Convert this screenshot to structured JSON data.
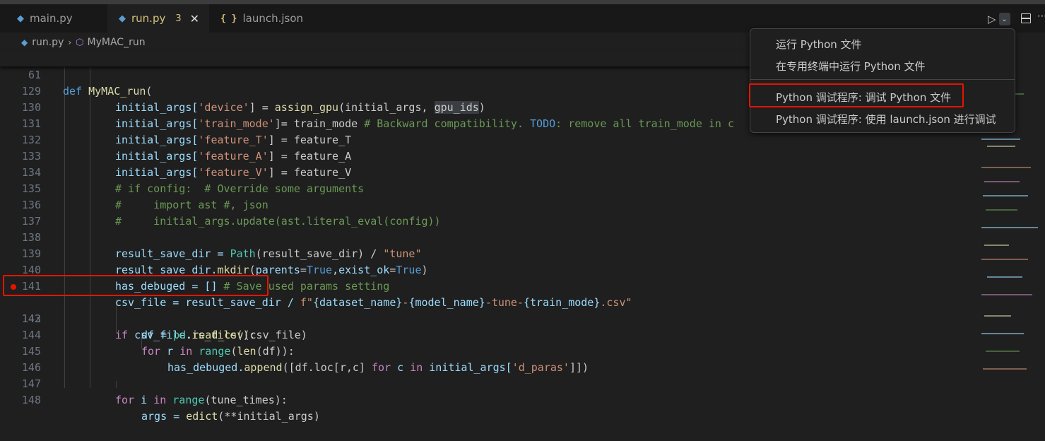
{
  "tabs": [
    {
      "label": "main.py",
      "icon": "python-file-icon"
    },
    {
      "label": "run.py",
      "icon": "python-file-icon",
      "problems": "3"
    },
    {
      "label": "launch.json",
      "icon": "json-braces-icon",
      "icon_text": "{ }"
    }
  ],
  "breadcrumb": {
    "file": "run.py",
    "symbol": "MyMAC_run"
  },
  "sticky": {
    "number": "61",
    "kw": "def",
    "fn": "MyMAC_run",
    "rest": "("
  },
  "code": {
    "l129": {
      "n": "129",
      "a": "initial_args[",
      "b": "'device'",
      "c": "] = ",
      "d": "assign_gpu",
      "e": "(initial_args, ",
      "f": "gpu_ids",
      "g": ")"
    },
    "l130": {
      "n": "130",
      "a": "initial_args[",
      "b": "'train_mode'",
      "c": "]= train_mode ",
      "d": "# Backward compatibility. ",
      "e": "TODO",
      "f": ": remove all train_mode in c"
    },
    "l131": {
      "n": "131",
      "a": "initial_args[",
      "b": "'feature_T'",
      "c": "] = feature_T"
    },
    "l132": {
      "n": "132",
      "a": "initial_args[",
      "b": "'feature_A'",
      "c": "] = feature_A"
    },
    "l133": {
      "n": "133",
      "a": "initial_args[",
      "b": "'feature_V'",
      "c": "] = feature_V"
    },
    "l134": {
      "n": "134",
      "a": "# if config:  # Override some arguments"
    },
    "l135": {
      "n": "135",
      "a": "#     import ast #, json"
    },
    "l136": {
      "n": "136",
      "a": "#     initial_args.update(ast.literal_eval(config))"
    },
    "l137": {
      "n": "137"
    },
    "l138": {
      "n": "138",
      "a": "result_save_dir = ",
      "b": "Path",
      "c": "(result_save_dir) / ",
      "d": "\"tune\""
    },
    "l139": {
      "n": "139",
      "a": "result_save_dir.",
      "b": "mkdir",
      "c": "(",
      "d": "parents",
      "e": "=",
      "f": "True",
      "g": ",",
      "h": "exist_ok",
      "i": "=",
      "j": "True",
      "k": ")"
    },
    "l140": {
      "n": "140",
      "a": "has_debuged = [] ",
      "b": "# Save used params setting"
    },
    "l141": {
      "n": "141",
      "a": "csv_file = result_save_dir / ",
      "b": "f\"",
      "c": "{dataset_name}",
      "d": "-",
      "e": "{model_name}",
      "f": "-tune-",
      "g": "{train_mode}",
      "h": ".csv\""
    },
    "l142": {
      "n": "142",
      "a": "if",
      "b": " csv_file.",
      "c": "is_file",
      "d": "():"
    },
    "l143": {
      "n": "143",
      "a": "df = ",
      "b": "pd",
      "c": ".",
      "d": "read_csv",
      "e": "(csv_file)"
    },
    "l144": {
      "n": "144",
      "a": "for",
      "b": " r ",
      "c": "in",
      "d": " ",
      "e": "range",
      "f": "(",
      "g": "len",
      "h": "(df)):"
    },
    "l145": {
      "n": "145",
      "a": "has_debuged.",
      "b": "append",
      "c": "([df.loc[r,c] ",
      "d": "for",
      "e": " c ",
      "f": "in",
      "g": " initial_args[",
      "h": "'d_paras'",
      "i": "]])"
    },
    "l146": {
      "n": "146"
    },
    "l147": {
      "n": "147",
      "a": "for",
      "b": " i ",
      "c": "in",
      "d": " ",
      "e": "range",
      "f": "(tune_times):"
    },
    "l148": {
      "n": "148",
      "a": "args = ",
      "b": "edict",
      "c": "(**initial_args)"
    }
  },
  "run_menu": [
    "运行 Python 文件",
    "在专用终端中运行 Python 文件",
    "Python 调试程序: 调试 Python 文件",
    "Python 调试程序: 使用 launch.json 进行调试"
  ],
  "colors": {
    "accent_modified": "#d4c47a",
    "breakpoint": "#e51400",
    "annotation_box": "#e51400"
  }
}
